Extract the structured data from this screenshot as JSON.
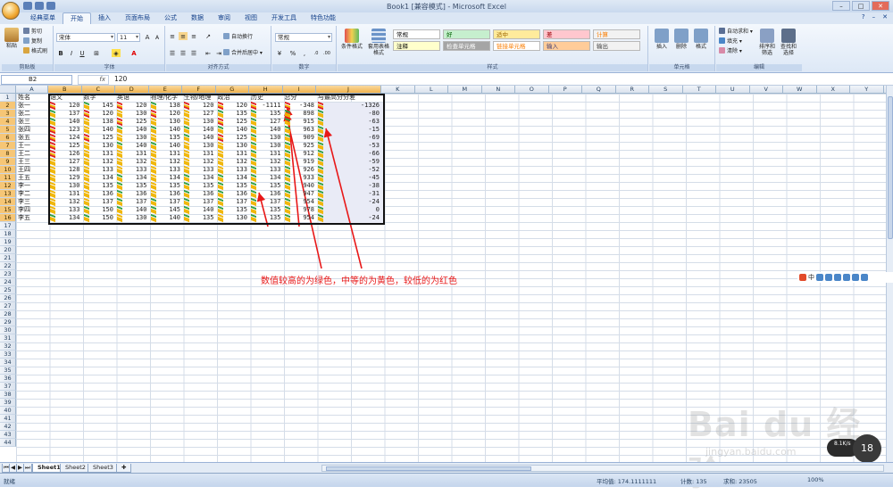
{
  "window": {
    "title": "Book1 [兼容模式] - Microsoft Excel"
  },
  "tabs": [
    "经典菜单",
    "开始",
    "插入",
    "页面布局",
    "公式",
    "数据",
    "审阅",
    "视图",
    "开发工具",
    "特色功能"
  ],
  "active_tab": "开始",
  "ribbon": {
    "clipboard": {
      "label": "剪贴板",
      "paste": "粘贴",
      "cut": "剪切",
      "copy": "复制",
      "format_painter": "格式刷"
    },
    "font": {
      "label": "字体",
      "font_name": "宋体",
      "font_size": "11"
    },
    "alignment": {
      "label": "对齐方式",
      "wrap": "自动换行",
      "merge": "合并后居中 ▾"
    },
    "number": {
      "label": "数字",
      "format": "常规"
    },
    "styles": {
      "label": "样式",
      "conditional": "条件格式",
      "table": "套用表格格式",
      "cells": [
        {
          "text": "常规",
          "bg": "#ffffff",
          "fg": "#000000"
        },
        {
          "text": "差",
          "bg": "#ffc7ce",
          "fg": "#9c0006"
        },
        {
          "text": "好",
          "bg": "#c6efce",
          "fg": "#006100"
        },
        {
          "text": "适中",
          "bg": "#ffeb9c",
          "fg": "#9c6500"
        },
        {
          "text": "计算",
          "bg": "#f2f2f2",
          "fg": "#fa7d00"
        },
        {
          "text": "检查单元格",
          "bg": "#a5a5a5",
          "fg": "#ffffff"
        },
        {
          "text": "解释性文本",
          "bg": "#ffffff",
          "fg": "#7f7f7f"
        },
        {
          "text": "警告文本",
          "bg": "#ffffff",
          "fg": "#ff0000"
        },
        {
          "text": "链接单元格",
          "bg": "#ffffff",
          "fg": "#fa7d00"
        },
        {
          "text": "输出",
          "bg": "#f2f2f2",
          "fg": "#3f3f3f"
        },
        {
          "text": "输入",
          "bg": "#ffcc99",
          "fg": "#3f3f76"
        },
        {
          "text": "注释",
          "bg": "#ffffcc",
          "fg": "#000000"
        }
      ]
    },
    "cells_group": {
      "label": "单元格",
      "insert": "插入",
      "delete": "删除",
      "format": "格式"
    },
    "editing": {
      "label": "编辑",
      "autosum": "自动求和 ▾",
      "fill": "填充 ▾",
      "clear": "清除 ▾",
      "sort": "排序和筛选",
      "find": "查找和选择"
    }
  },
  "formula_bar": {
    "name_box": "B2",
    "fx": "fx",
    "value": "120"
  },
  "columns": [
    "A",
    "B",
    "C",
    "D",
    "E",
    "F",
    "G",
    "H",
    "I",
    "J",
    "K",
    "L",
    "M",
    "N",
    "O",
    "P",
    "Q",
    "R",
    "S",
    "T",
    "U",
    "V",
    "W",
    "X",
    "Y",
    "Z"
  ],
  "selected_columns": [
    "B",
    "C",
    "D",
    "E",
    "F",
    "G",
    "H",
    "I",
    "J"
  ],
  "headers": [
    "姓名",
    "语文",
    "数学",
    "英语",
    "物理/化学",
    "生物/地理",
    "政治",
    "历史",
    "总分",
    "与最高分分差"
  ],
  "rows": [
    [
      "张一",
      "120",
      "145",
      "120",
      "138",
      "120",
      "120",
      "-1111",
      "-348",
      "-1326"
    ],
    [
      "张二",
      "137",
      "120",
      "130",
      "120",
      "127",
      "135",
      "135",
      "898",
      "-80"
    ],
    [
      "张三",
      "140",
      "138",
      "125",
      "130",
      "130",
      "125",
      "127",
      "915",
      "-63"
    ],
    [
      "张四",
      "123",
      "140",
      "140",
      "140",
      "140",
      "140",
      "140",
      "963",
      "-15"
    ],
    [
      "张五",
      "124",
      "125",
      "130",
      "135",
      "140",
      "125",
      "130",
      "909",
      "-69"
    ],
    [
      "王一",
      "125",
      "130",
      "140",
      "140",
      "130",
      "130",
      "130",
      "925",
      "-53"
    ],
    [
      "王二",
      "126",
      "131",
      "131",
      "131",
      "131",
      "131",
      "131",
      "912",
      "-66"
    ],
    [
      "王三",
      "127",
      "132",
      "132",
      "132",
      "132",
      "132",
      "132",
      "919",
      "-59"
    ],
    [
      "王四",
      "128",
      "133",
      "133",
      "133",
      "133",
      "133",
      "133",
      "926",
      "-52"
    ],
    [
      "王五",
      "129",
      "134",
      "134",
      "134",
      "134",
      "134",
      "134",
      "933",
      "-45"
    ],
    [
      "李一",
      "130",
      "135",
      "135",
      "135",
      "135",
      "135",
      "135",
      "940",
      "-38"
    ],
    [
      "李二",
      "131",
      "136",
      "136",
      "136",
      "136",
      "136",
      "136",
      "947",
      "-31"
    ],
    [
      "李三",
      "132",
      "137",
      "137",
      "137",
      "137",
      "137",
      "137",
      "954",
      "-24"
    ],
    [
      "李四",
      "133",
      "150",
      "140",
      "145",
      "140",
      "135",
      "135",
      "978",
      "0"
    ],
    [
      "李五",
      "134",
      "150",
      "130",
      "140",
      "135",
      "130",
      "135",
      "954",
      "-24"
    ]
  ],
  "row_count": 44,
  "annotation": "数值较高的为绿色，中等的为黄色，较低的为红色",
  "sheet_tabs": [
    "Sheet1",
    "Sheet2",
    "Sheet3"
  ],
  "active_sheet": "Sheet1",
  "status": {
    "mode": "就绪",
    "average": "平均值: 174.1111111",
    "count": "计数: 135",
    "sum": "求和: 23505",
    "zoom": "100%"
  },
  "watermark": {
    "logo": "Bai du 经验",
    "url": "jingyan.baidu.com"
  },
  "net_widget": {
    "speed": "8.1K/s",
    "value": "18"
  }
}
